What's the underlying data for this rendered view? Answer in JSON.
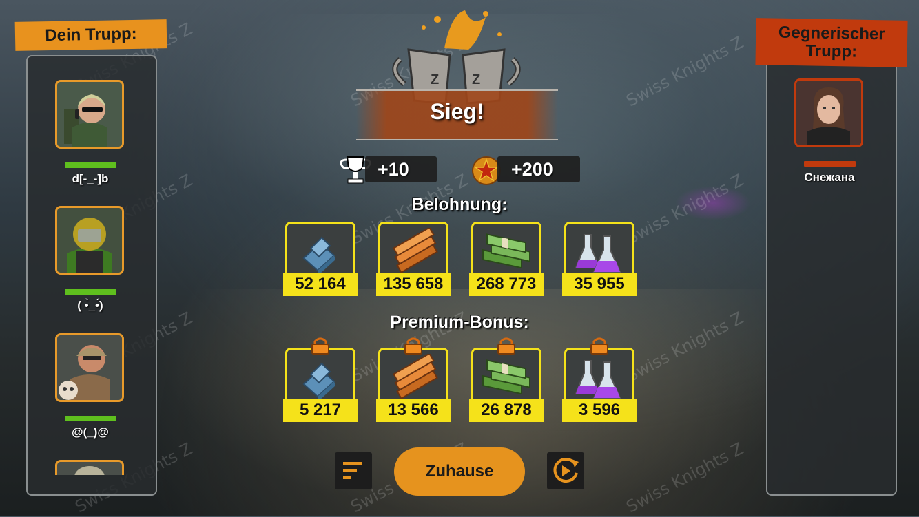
{
  "left_panel": {
    "title": "Dein Trupp:",
    "members": [
      {
        "name": "d[-_-]b",
        "hp": 1.0
      },
      {
        "name": "( •̀_•́)",
        "hp": 1.0
      },
      {
        "name": "@(_)@",
        "hp": 1.0
      }
    ]
  },
  "right_panel": {
    "title": "Gegnerischer Trupp:",
    "members": [
      {
        "name": "Снежана",
        "hp": 1.0
      }
    ]
  },
  "result": {
    "title": "Sieg!",
    "trophy_gain": "+10",
    "star_gain": "+200"
  },
  "rewards": {
    "title": "Belohnung:",
    "items": [
      {
        "icon": "steel-ingot-icon",
        "value": "52 164"
      },
      {
        "icon": "wood-planks-icon",
        "value": "135 658"
      },
      {
        "icon": "cash-stack-icon",
        "value": "268 773"
      },
      {
        "icon": "potion-flasks-icon",
        "value": "35 955"
      }
    ]
  },
  "premium": {
    "title": "Premium-Bonus:",
    "items": [
      {
        "icon": "steel-ingot-icon",
        "value": "5 217"
      },
      {
        "icon": "wood-planks-icon",
        "value": "13 566"
      },
      {
        "icon": "cash-stack-icon",
        "value": "26 878"
      },
      {
        "icon": "potion-flasks-icon",
        "value": "3 596"
      }
    ]
  },
  "buttons": {
    "home": "Zuhause",
    "stats_icon": "bars-icon",
    "replay_icon": "replay-icon"
  },
  "watermark": "Swiss Knights Z",
  "colors": {
    "accent_orange": "#e6931e",
    "enemy_red": "#c13a0d",
    "reward_yellow": "#f5e21a",
    "hp_green": "#5fbf1e"
  }
}
